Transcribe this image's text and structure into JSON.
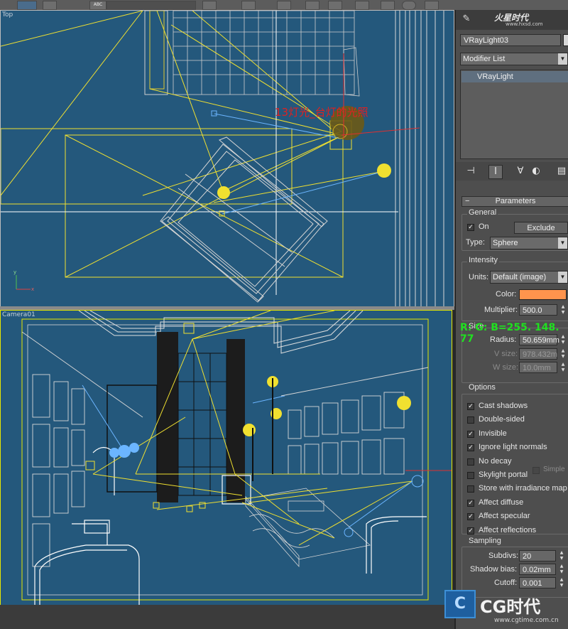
{
  "toolbar": {
    "text_tool_label": "ABC"
  },
  "viewports": {
    "top_label": "Top",
    "camera_label": "Camera01",
    "annotation_red": "13灯光_台灯的光照",
    "annotation_green": "R: G: B=255. 148. 77"
  },
  "panel": {
    "watermark": "火星时代",
    "watermark_url": "www.hxsd.com",
    "object_name": "VRayLight03",
    "modifier_list": "Modifier List",
    "stack_item": "VRayLight",
    "parameters_title": "Parameters",
    "general": {
      "title": "General",
      "on_label": "On",
      "on_checked": true,
      "exclude_label": "Exclude",
      "type_label": "Type:",
      "type_value": "Sphere"
    },
    "intensity": {
      "title": "Intensity",
      "units_label": "Units:",
      "units_value": "Default (image)",
      "color_label": "Color:",
      "color_hex": "#ff944d",
      "multiplier_label": "Multiplier:",
      "multiplier_value": "500.0"
    },
    "size": {
      "title": "Size",
      "radius_label": "Radius:",
      "radius_value": "50.659mm",
      "vsize_label": "V size:",
      "vsize_value": "978.432m",
      "wsize_label": "W size:",
      "wsize_value": "10.0mm"
    },
    "options": {
      "title": "Options",
      "items": [
        {
          "label": "Cast shadows",
          "checked": true
        },
        {
          "label": "Double-sided",
          "checked": false
        },
        {
          "label": "Invisible",
          "checked": true
        },
        {
          "label": "Ignore light normals",
          "checked": true
        },
        {
          "label": "No decay",
          "checked": false
        },
        {
          "label": "Skylight portal",
          "checked": false
        },
        {
          "label": "Store with irradiance map",
          "checked": false
        },
        {
          "label": "Affect diffuse",
          "checked": true
        },
        {
          "label": "Affect specular",
          "checked": true
        },
        {
          "label": "Affect reflections",
          "checked": true
        }
      ],
      "simple_label": "Simple"
    },
    "sampling": {
      "title": "Sampling",
      "subdivs_label": "Subdivs:",
      "subdivs_value": "20",
      "shadow_bias_label": "Shadow bias:",
      "shadow_bias_value": "0.02mm",
      "cutoff_label": "Cutoff:",
      "cutoff_value": "0.001"
    }
  },
  "logo": {
    "text": "CG时代",
    "url": "www.cgtime.com.cn"
  },
  "colors": {
    "viewport_bg": "#24587c",
    "light_yellow": "#f0e030",
    "light_blue": "#6bb5ff",
    "wire_white": "#d8d8d8"
  }
}
